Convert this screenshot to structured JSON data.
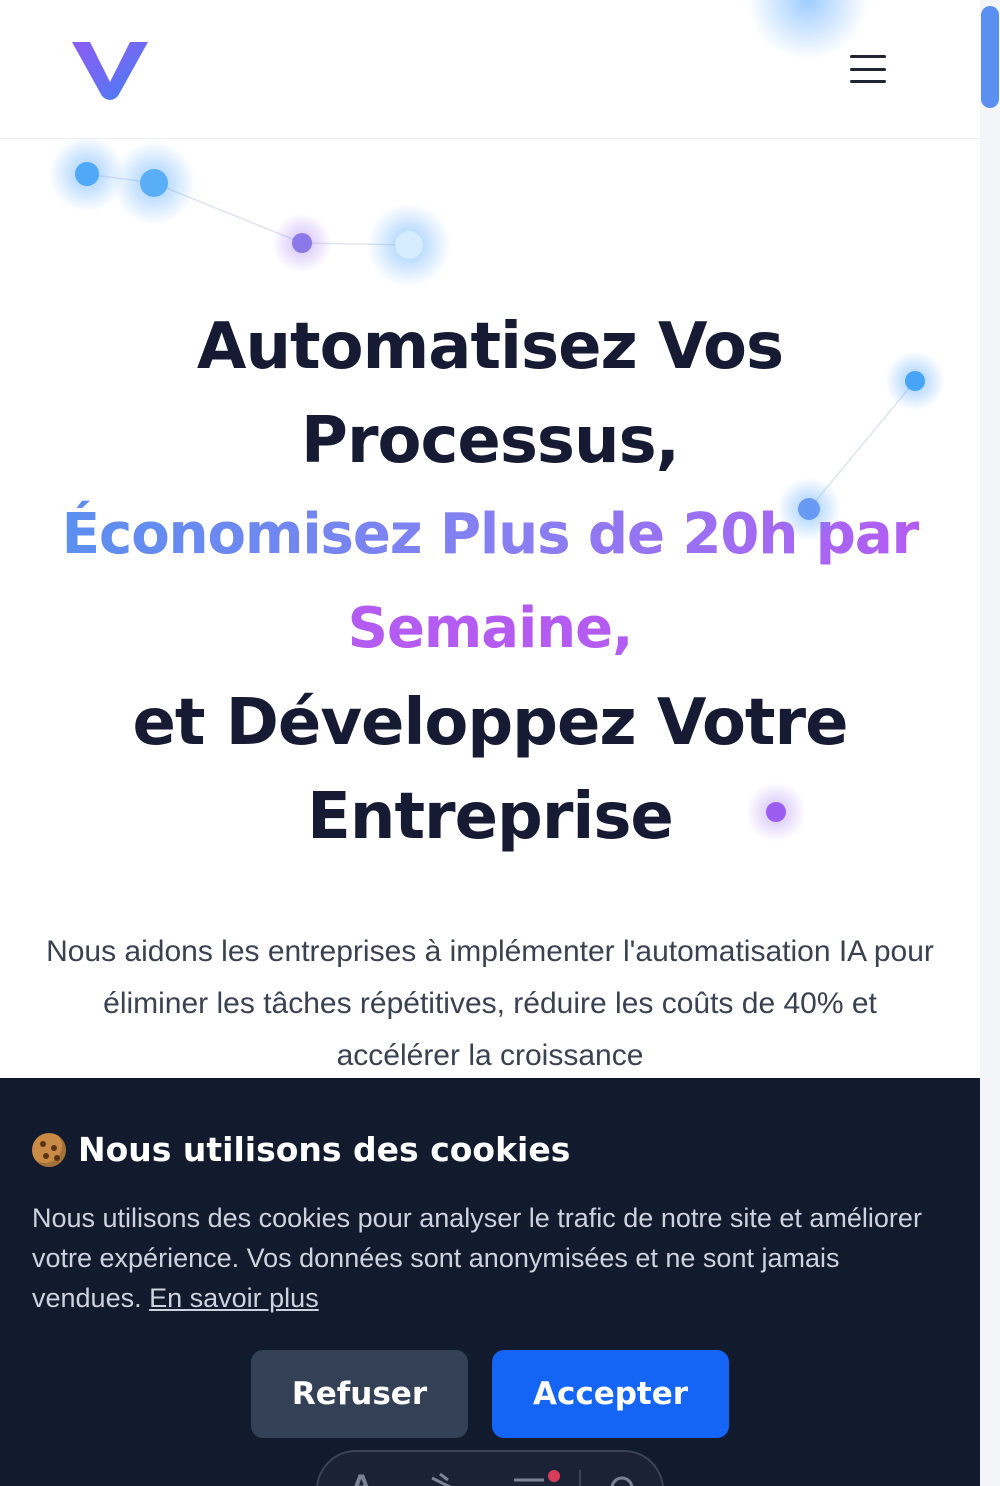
{
  "header": {
    "logo_alt": "V",
    "menu_icon": "hamburger-menu-icon"
  },
  "hero": {
    "title_line1": "Automatisez Vos",
    "title_line2": "Processus,",
    "title_highlight_line1": "Économisez Plus de 20h par",
    "title_highlight_line2": "Semaine,",
    "title_line3": "et Développez Votre",
    "title_line4": "Entreprise",
    "subtitle": "Nous aidons les entreprises à implémenter l'automatisation IA pour éliminer les tâches répétitives, réduire les coûts de 40% et accélérer la croissance"
  },
  "cookie_banner": {
    "icon": "cookie-icon",
    "title": "Nous utilisons des cookies",
    "text": "Nous utilisons des cookies pour analyser le trafic de notre site et améliorer votre expérience. Vos données sont anonymisées et ne sont jamais vendues.",
    "link": "En savoir plus",
    "refuse_label": "Refuser",
    "accept_label": "Accepter"
  },
  "colors": {
    "brand_blue": "#5b8ff0",
    "brand_purple": "#b45cf2",
    "accept_button": "#1465f5",
    "refuse_button": "#334055",
    "banner_bg": "#121a2e"
  }
}
